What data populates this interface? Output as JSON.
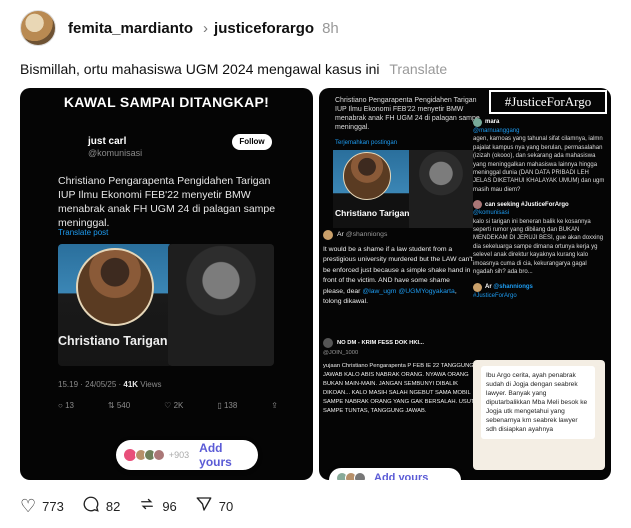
{
  "post": {
    "username": "femita_mardianto",
    "chevron": "›",
    "community": "justiceforargo",
    "time": "8h",
    "caption": "Bismillah, ortu mahasiswa UGM 2024 mengawal kasus ini",
    "translate_label": "Translate"
  },
  "image1": {
    "banner": "KAWAL SAMPAI DITANGKAP!",
    "tweet": {
      "name": "just carl",
      "handle": "@komunisasi",
      "follow_label": "Follow",
      "text": "Christiano Pengarapenta Pengidahen Tarigan IUP Ilmu Ekonomi FEB'22 menyetir BMW menabrak anak FH UGM 24 di palagan sampe meninggal.",
      "translate_label": "Translate post",
      "photo_caption": "Christiano Tarigan",
      "meta": "15.19 · 24/05/25 · ",
      "views": "41K",
      "views_label": " Views",
      "replies": "13",
      "reposts": "540",
      "likes": "2K",
      "bookmarks": "138"
    },
    "add_yours": {
      "count": "+903",
      "label": "Add yours"
    }
  },
  "image2": {
    "title": "#JusticeForArgo",
    "text_top": "Christiano Pengarapenta Pengidahen Tarigan IUP Ilmu Ekonomi FEB'22 menyetir BMW menabrak anak FH UGM 24 di palagan sampe meninggal.",
    "translate_small": "Terjemahkan postingan",
    "photo_caption": "Christiano Tarigan",
    "post_a": {
      "name": "Ar",
      "handle": "@shanniongs",
      "text_plain": "It would be a shame if a law student from a prestigious university murdered but the LAW can't be enforced just because a simple shake hand in front of the victim. AND have some shame please, dear ",
      "mention1": "@law_ugm",
      "mention2": "@UGMYogyakarta",
      "text_end": ", tolong dikawal."
    },
    "post_b": {
      "name": "NO DM - KRIM FESS DOK HKI...",
      "handle": "@JOIN_1000",
      "text": "yujaan Christiano Pengarapenta P FEB IE 22 TANGGUNG JAWAB KALO ABIS NABRAK ORANG. NYAWA ORANG BUKAN MAIN-MAIN. JANGAN SEMBUNYI DIBALIK DIKOAN... KALO MASIH SALAH NGEBUT SAMA MOBIL SAMPE NABRAK ORANG YANG GAK BERSALAH. USUT SAMPE TUNTAS, TANGGUNG JAWAB."
    },
    "right_posts": [
      {
        "name": "mara",
        "handle": "@marnuanggang",
        "text": "agen, karnoas yang tahunal sifat cilamnya, ialmn pajalat kampus nya yang berulan, permasalahan (izizah (okooo), dan sekarang ada mahasiswa yang meninggalkan mahasiswa lainnya hingga meninggal dunia (DAN DATA PRIBADI LEH JELAS DIKETAHUI KHALAYAK UMUM) dan ugm masih mau diem?"
      },
      {
        "name": "can seeking #JusticeForArgo",
        "handle": "@komunisasi",
        "text": "kalo si tarigan ini beneran balik ke kosannya seperti rumor yang dibilang dan BUKAN MENDEKAM DI JERUJI BESI, gue akan doxxing dia sekeluarga sampe dimana ortunya kerja yg seleveI anak direktur kayaknya kurang kalo imoasnya cuma di cia, kekurangarya gagal ngadah sih? ada bro..."
      },
      {
        "name": "Ar",
        "handle": "@shanniongs",
        "hashtag": "#JusticeForArgo"
      }
    ],
    "chat": "Ibu Argo cerita, ayah penabrak sudah di Jogja dengan seabrek lawyer. Banyak yang diputarbalikkan Mba Meli besok ke Jogja utk mengetahui yang sebenarnya krn seabrek lawyer sdh disiapkan ayahnya",
    "add_yours_label": "Add yours"
  },
  "footer": {
    "likes": "773",
    "comments": "82",
    "reposts": "96",
    "shares": "70"
  }
}
